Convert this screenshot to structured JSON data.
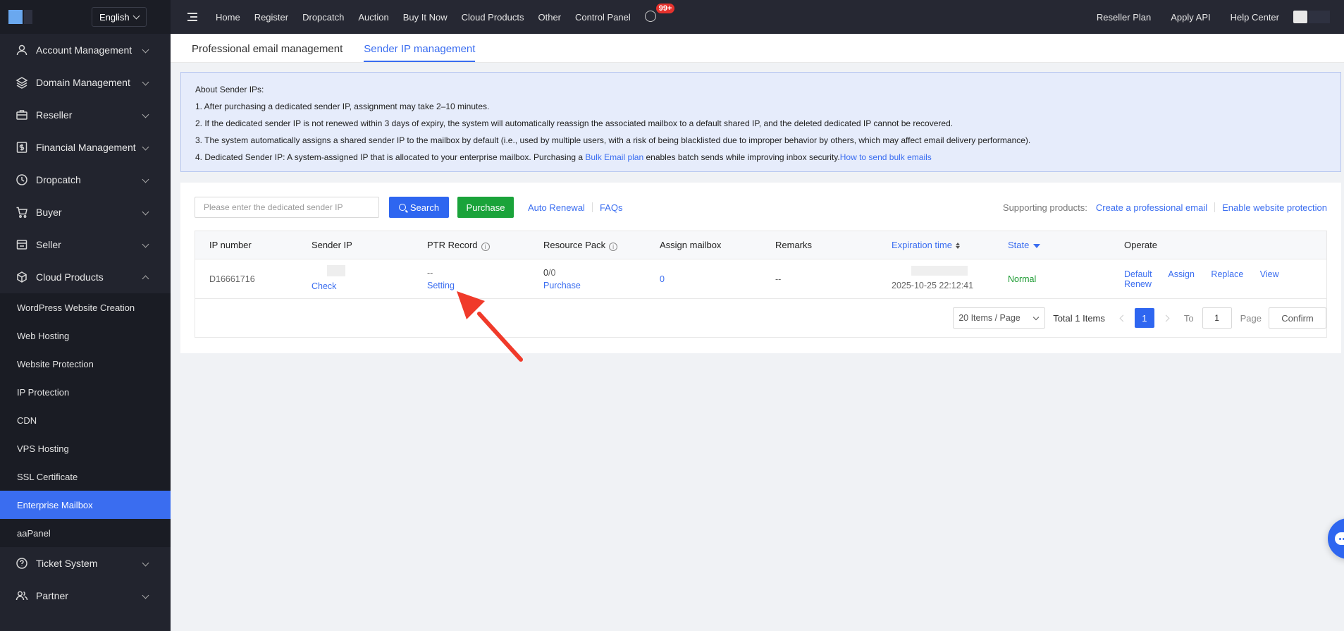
{
  "sidebar": {
    "language": "English",
    "items": [
      {
        "label": "Account Management",
        "icon": "user-icon"
      },
      {
        "label": "Domain Management",
        "icon": "layers-icon"
      },
      {
        "label": "Reseller",
        "icon": "briefcase-icon"
      },
      {
        "label": "Financial Management",
        "icon": "dollar-icon"
      },
      {
        "label": "Dropcatch",
        "icon": "clock-icon"
      },
      {
        "label": "Buyer",
        "icon": "cart-icon"
      },
      {
        "label": "Seller",
        "icon": "store-icon"
      },
      {
        "label": "Cloud Products",
        "icon": "cloud-icon"
      }
    ],
    "cloud_sub": [
      "WordPress Website Creation",
      "Web Hosting",
      "Website Protection",
      "IP Protection",
      "CDN",
      "VPS Hosting",
      "SSL Certificate",
      "Enterprise Mailbox",
      "aaPanel"
    ],
    "bottom_items": [
      {
        "label": "Ticket System",
        "icon": "help-icon"
      },
      {
        "label": "Partner",
        "icon": "partner-icon"
      }
    ]
  },
  "topnav": {
    "links": [
      "Home",
      "Register",
      "Dropcatch",
      "Auction",
      "Buy It Now",
      "Cloud Products",
      "Other",
      "Control Panel"
    ],
    "badge": "99+",
    "right_links": [
      "Reseller Plan",
      "Apply API",
      "Help Center"
    ]
  },
  "tabs": [
    "Professional email management",
    "Sender IP management"
  ],
  "notice": {
    "title": "About Sender IPs:",
    "line1": "1. After purchasing a dedicated sender IP, assignment may take 2–10 minutes.",
    "line2": "2. If the dedicated sender IP is not renewed within 3 days of expiry, the system will automatically reassign the associated mailbox to a default shared IP, and the deleted dedicated IP cannot be recovered.",
    "line3": "3. The system automatically assigns a shared sender IP to the mailbox by default (i.e., used by multiple users, with a risk of being blacklisted due to improper behavior by others, which may affect email delivery performance).",
    "line4_a": "4. Dedicated Sender IP: A system-assigned IP that is allocated to your enterprise mailbox. Purchasing a ",
    "line4_link1": "Bulk Email plan",
    "line4_b": " enables batch sends while improving inbox security.",
    "line4_link2": "How to send bulk emails"
  },
  "toolbar": {
    "search_placeholder": "Please enter the dedicated sender IP",
    "search_label": "Search",
    "purchase_label": "Purchase",
    "auto_renewal": "Auto Renewal",
    "faqs": "FAQs",
    "supporting_label": "Supporting products:",
    "create_email": "Create a professional email",
    "enable_protection": "Enable website protection"
  },
  "table": {
    "headers": [
      "IP number",
      "Sender IP",
      "PTR Record",
      "Resource Pack",
      "Assign mailbox",
      "Remarks",
      "Expiration time",
      "State",
      "Operate"
    ],
    "row": {
      "ip_number": "D16661716",
      "sender_ip_link": "Check",
      "ptr_value": "--",
      "ptr_link": "Setting",
      "resource_pack_used": "0",
      "resource_pack_sep": "/",
      "resource_pack_total": "0",
      "resource_link": "Purchase",
      "assign_mailbox": "0",
      "remarks": "--",
      "expiration": "2025-10-25 22:12:41",
      "state": "Normal",
      "operations": [
        "Default",
        "Assign",
        "Replace",
        "View",
        "Renew"
      ]
    }
  },
  "pagination": {
    "page_size": "20 Items / Page",
    "total": "Total 1 Items",
    "current_page": "1",
    "to_label": "To",
    "page_input": "1",
    "page_label": "Page",
    "confirm": "Confirm"
  },
  "colors": {
    "accent": "#3a6df0",
    "sidebar_bg": "#22242e",
    "purchase_green": "#1aa33a",
    "arrow_red": "#f03a2a"
  }
}
